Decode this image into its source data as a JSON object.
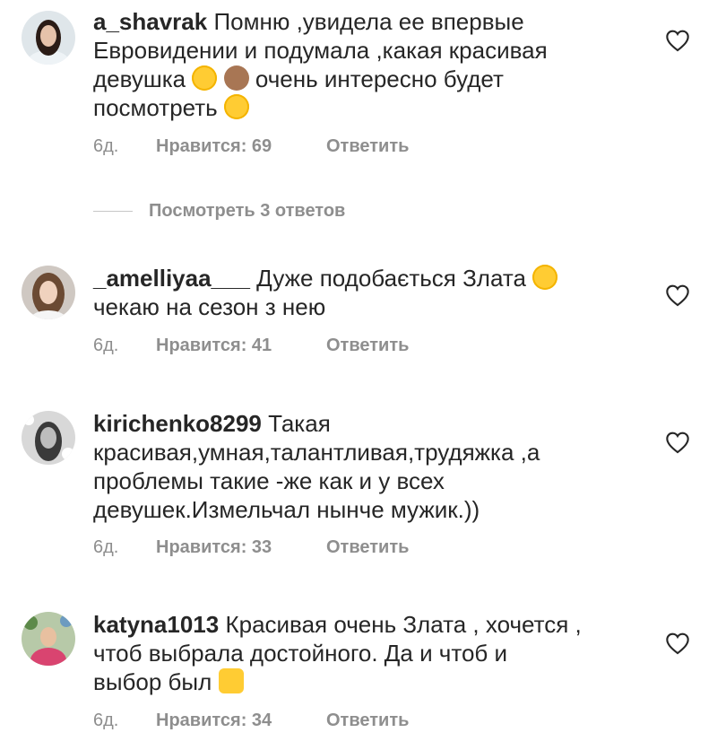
{
  "comments": [
    {
      "username": "a_shavrak",
      "lines": [
        "Помню ,увидела ее впервые",
        "Евровидении и подумала ,какая красивая",
        "девушка ",
        " очень интересно будет",
        "посмотреть "
      ],
      "time": "6д.",
      "likes": "Нравится: 69",
      "reply": "Ответить",
      "emojis": [
        "heart-eyes-emoji",
        "see-no-evil-monkey-emoji",
        "smiling-face-emoji"
      ]
    },
    {
      "username": "_amelliyaa___",
      "lines": [
        " Дуже подобається Злата ",
        "чекаю на сезон з нею"
      ],
      "time": "6д.",
      "likes": "Нравится: 41",
      "reply": "Ответить",
      "emojis": [
        "heart-eyes-emoji"
      ]
    },
    {
      "username": "kirichenko8299",
      "lines": [
        " Такая",
        "красивая,умная,талантливая,трудяжка ,а",
        "проблемы такие -же  как и у всех",
        "девушек.Измельчал нынче мужик.))"
      ],
      "time": "6д.",
      "likes": "Нравится: 33",
      "reply": "Ответить",
      "emojis": []
    },
    {
      "username": "katyna1013",
      "lines": [
        " Красивая очень Злата , хочется ,",
        "чтоб выбрала достойного. Да и чтоб и",
        "выбор был "
      ],
      "time": "6д.",
      "likes": "Нравится: 34",
      "reply": "Ответить",
      "emojis": [
        "raising-hands-emoji"
      ]
    }
  ],
  "view_replies": "Посмотреть 3 ответов",
  "colors": {
    "text": "#262626",
    "secondary": "#8e8e8e"
  }
}
